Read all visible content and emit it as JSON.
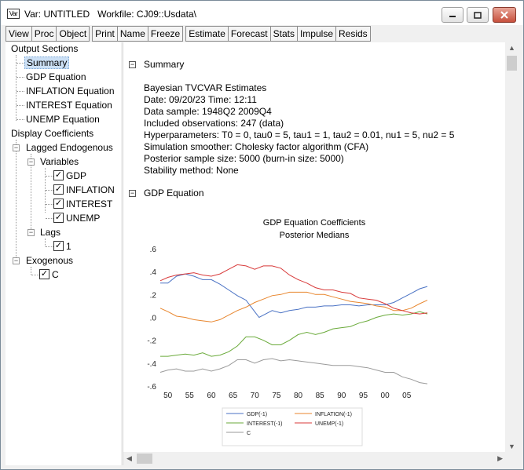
{
  "window": {
    "icon_text": "Var",
    "title": "Var: UNTITLED   Workfile: CJ09::Usdata\\"
  },
  "toolbar": {
    "view": "View",
    "proc": "Proc",
    "object": "Object",
    "print": "Print",
    "name": "Name",
    "freeze": "Freeze",
    "estimate": "Estimate",
    "forecast": "Forecast",
    "stats": "Stats",
    "impulse": "Impulse",
    "resids": "Resids"
  },
  "tree": {
    "output_sections": "Output Sections",
    "summary": "Summary",
    "gdp_eq": "GDP Equation",
    "inflation_eq": "INFLATION Equation",
    "interest_eq": "INTEREST Equation",
    "unemp_eq": "UNEMP Equation",
    "display_coef": "Display Coefficients",
    "lagged": "Lagged Endogenous",
    "variables": "Variables",
    "var_gdp": "GDP",
    "var_inflation": "INFLATION",
    "var_interest": "INTEREST",
    "var_unemp": "UNEMP",
    "lags": "Lags",
    "lag_1": "1",
    "exogenous": "Exogenous",
    "exo_c": "C"
  },
  "output": {
    "summary_header": "Summary",
    "lines": [
      "Bayesian TVCVAR Estimates",
      "Date: 09/20/23   Time: 12:11",
      "Data sample: 1948Q2 2009Q4",
      "Included observations: 247 (data)",
      "Hyperparameters: T0 = 0, tau0 = 5, tau1 = 1, tau2 = 0.01, nu1 = 5, nu2 = 5",
      "Simulation smoother: Cholesky factor algorithm (CFA)",
      "Posterior sample size: 5000 (burn-in size: 5000)",
      "Stability method: None"
    ],
    "gdp_header": "GDP Equation"
  },
  "chart_data": {
    "type": "line",
    "title": "GDP Equation Coefficients",
    "subtitle": "Posterior Medians",
    "xlabel": "",
    "ylabel": "",
    "xlim": [
      1948.25,
      2009.75
    ],
    "ylim": [
      -0.6,
      0.6
    ],
    "x_ticks": [
      "50",
      "55",
      "60",
      "65",
      "70",
      "75",
      "80",
      "85",
      "90",
      "95",
      "00",
      "05"
    ],
    "x_tick_values": [
      1950,
      1955,
      1960,
      1965,
      1970,
      1975,
      1980,
      1985,
      1990,
      1995,
      2000,
      2005
    ],
    "y_ticks": [
      ".6",
      ".4",
      ".2",
      ".0",
      "-.2",
      "-.4",
      "-.6"
    ],
    "y_tick_values": [
      0.6,
      0.4,
      0.2,
      0.0,
      -0.2,
      -0.4,
      -0.6
    ],
    "grid": false,
    "legend_position": "bottom",
    "series": [
      {
        "name": "GDP(-1)",
        "color": "#4a72c4",
        "x": [
          1948.25,
          1950,
          1952,
          1954,
          1956,
          1958,
          1960,
          1962,
          1964,
          1966,
          1968,
          1970,
          1971,
          1972,
          1974,
          1976,
          1978,
          1980,
          1982,
          1984,
          1986,
          1988,
          1990,
          1992,
          1994,
          1996,
          1998,
          2000,
          2002,
          2004,
          2006,
          2008,
          2009.75
        ],
        "y": [
          0.3,
          0.3,
          0.36,
          0.38,
          0.36,
          0.33,
          0.33,
          0.29,
          0.24,
          0.19,
          0.15,
          0.05,
          0.0,
          0.02,
          0.06,
          0.04,
          0.06,
          0.07,
          0.09,
          0.09,
          0.1,
          0.1,
          0.11,
          0.11,
          0.1,
          0.11,
          0.11,
          0.11,
          0.13,
          0.17,
          0.21,
          0.25,
          0.27
        ]
      },
      {
        "name": "INFLATION(-1)",
        "color": "#e8862e",
        "x": [
          1948.25,
          1950,
          1952,
          1954,
          1956,
          1958,
          1960,
          1962,
          1964,
          1966,
          1968,
          1970,
          1972,
          1974,
          1976,
          1978,
          1980,
          1982,
          1984,
          1986,
          1988,
          1990,
          1992,
          1994,
          1996,
          1998,
          2000,
          2002,
          2004,
          2006,
          2008,
          2009.75
        ],
        "y": [
          0.08,
          0.05,
          0.01,
          0.0,
          -0.02,
          -0.03,
          -0.04,
          -0.02,
          0.02,
          0.06,
          0.09,
          0.13,
          0.16,
          0.19,
          0.2,
          0.22,
          0.22,
          0.22,
          0.2,
          0.2,
          0.18,
          0.16,
          0.14,
          0.13,
          0.12,
          0.1,
          0.09,
          0.06,
          0.06,
          0.08,
          0.12,
          0.15
        ]
      },
      {
        "name": "INTEREST(-1)",
        "color": "#6aaa3a",
        "x": [
          1948.25,
          1950,
          1952,
          1954,
          1956,
          1958,
          1960,
          1962,
          1964,
          1966,
          1968,
          1970,
          1972,
          1974,
          1976,
          1978,
          1980,
          1982,
          1984,
          1986,
          1988,
          1990,
          1992,
          1994,
          1996,
          1998,
          2000,
          2002,
          2004,
          2006,
          2008,
          2009.75
        ],
        "y": [
          -0.34,
          -0.34,
          -0.33,
          -0.32,
          -0.33,
          -0.31,
          -0.34,
          -0.33,
          -0.3,
          -0.25,
          -0.17,
          -0.17,
          -0.2,
          -0.24,
          -0.24,
          -0.2,
          -0.15,
          -0.13,
          -0.15,
          -0.13,
          -0.1,
          -0.09,
          -0.08,
          -0.05,
          -0.03,
          0.0,
          0.02,
          0.03,
          0.02,
          0.03,
          0.05,
          0.03
        ]
      },
      {
        "name": "UNEMP(-1)",
        "color": "#d83a3a",
        "x": [
          1948.25,
          1950,
          1952,
          1954,
          1956,
          1958,
          1960,
          1962,
          1964,
          1966,
          1968,
          1970,
          1972,
          1974,
          1976,
          1978,
          1980,
          1982,
          1984,
          1986,
          1988,
          1990,
          1992,
          1994,
          1996,
          1998,
          2000,
          2002,
          2004,
          2006,
          2008,
          2009.75
        ],
        "y": [
          0.32,
          0.35,
          0.37,
          0.38,
          0.39,
          0.37,
          0.36,
          0.38,
          0.42,
          0.46,
          0.45,
          0.42,
          0.45,
          0.45,
          0.43,
          0.37,
          0.33,
          0.3,
          0.26,
          0.24,
          0.24,
          0.22,
          0.21,
          0.17,
          0.16,
          0.15,
          0.12,
          0.08,
          0.06,
          0.04,
          0.03,
          0.04
        ]
      },
      {
        "name": "C",
        "color": "#9a9a9a",
        "x": [
          1948.25,
          1950,
          1952,
          1954,
          1956,
          1958,
          1960,
          1962,
          1964,
          1966,
          1968,
          1970,
          1972,
          1974,
          1976,
          1978,
          1980,
          1982,
          1984,
          1986,
          1988,
          1990,
          1992,
          1994,
          1996,
          1998,
          2000,
          2002,
          2004,
          2006,
          2008,
          2009.75
        ],
        "y": [
          -0.48,
          -0.46,
          -0.45,
          -0.47,
          -0.47,
          -0.45,
          -0.47,
          -0.45,
          -0.42,
          -0.37,
          -0.37,
          -0.4,
          -0.37,
          -0.36,
          -0.38,
          -0.37,
          -0.38,
          -0.39,
          -0.4,
          -0.41,
          -0.42,
          -0.42,
          -0.42,
          -0.43,
          -0.44,
          -0.46,
          -0.48,
          -0.48,
          -0.52,
          -0.54,
          -0.57,
          -0.58
        ]
      }
    ]
  }
}
